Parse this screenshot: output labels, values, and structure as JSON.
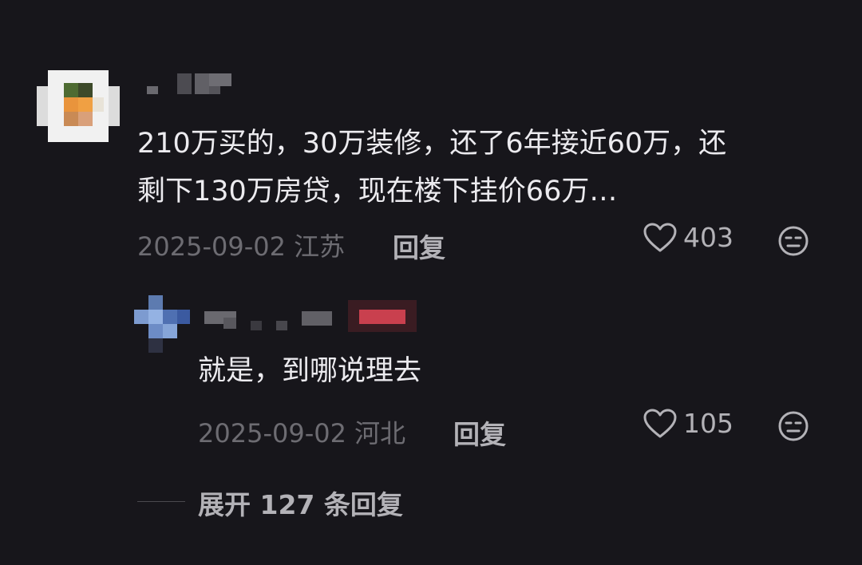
{
  "comment": {
    "text_line1": "210万买的，30万装修，还了6年接近60万，还",
    "text_line2": "剩下130万房贷，现在楼下挂价66万…",
    "date": "2025-09-02",
    "location": "江苏",
    "reply_label": "回复",
    "likes": "403",
    "like_icon": "heart-outline-icon",
    "dislike_icon": "frown-face-icon"
  },
  "reply": {
    "text": "就是，到哪说理去",
    "date": "2025-09-02",
    "location": "河北",
    "reply_label": "回复",
    "likes": "105"
  },
  "expand": {
    "label": "展开 127 条回复"
  },
  "colors": {
    "background": "#17161b",
    "text_primary": "#ecebef",
    "text_secondary": "#6d6c72",
    "text_action": "#b3b2b7"
  }
}
